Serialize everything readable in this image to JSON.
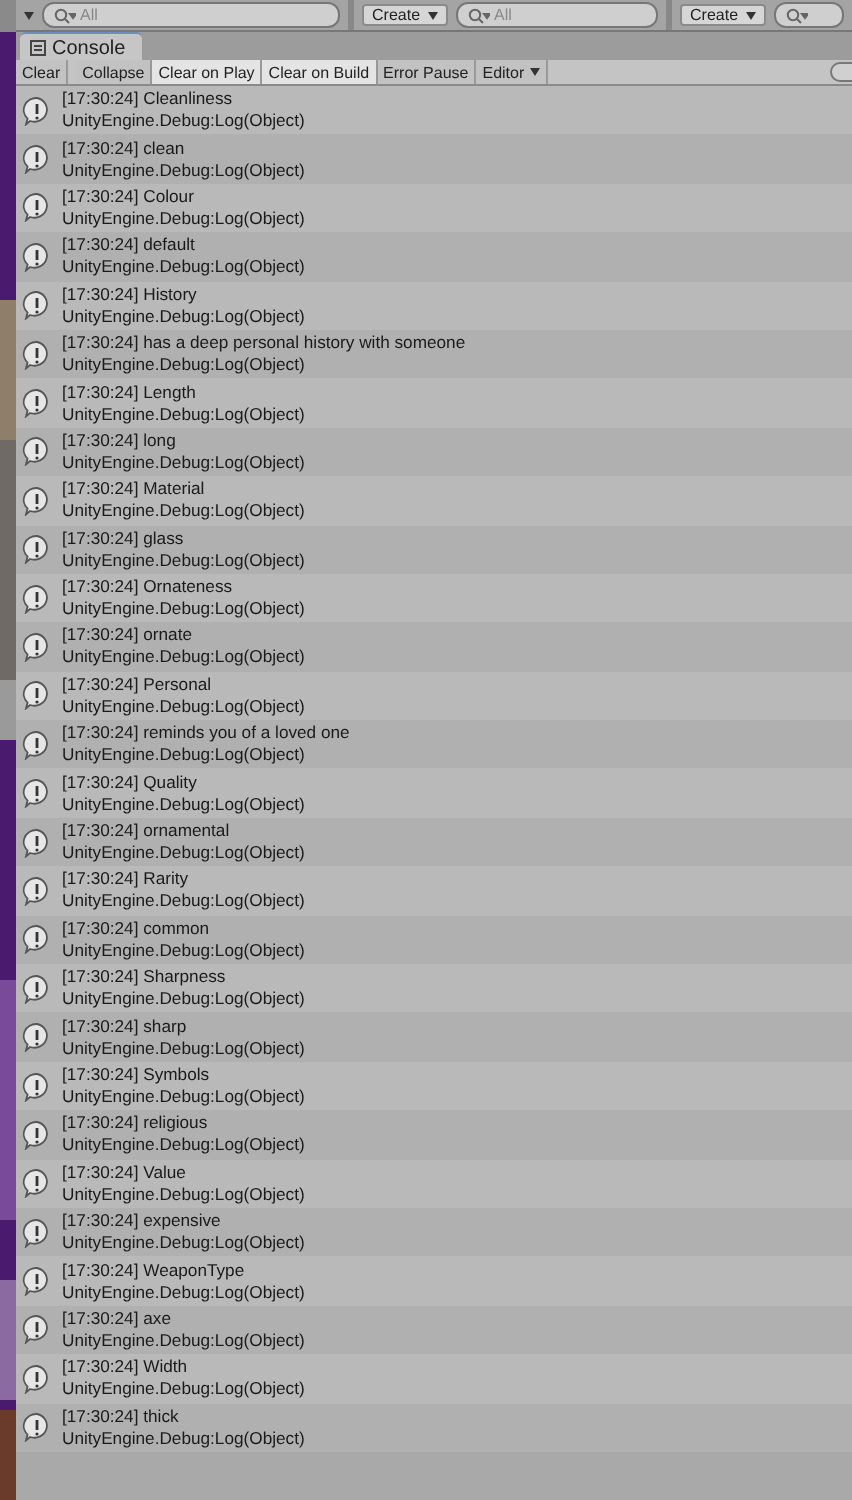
{
  "top_bar": {
    "panels": [
      {
        "search": "All"
      },
      {
        "create": "Create",
        "search": "All"
      },
      {
        "create": "Create"
      }
    ]
  },
  "tab": {
    "label": "Console",
    "selected": true
  },
  "toolbar": [
    {
      "label": "Clear",
      "on": false,
      "kind": "button"
    },
    {
      "label": "Collapse",
      "on": false,
      "kind": "button"
    },
    {
      "label": "Clear on Play",
      "on": true,
      "kind": "toggle"
    },
    {
      "label": "Clear on Build",
      "on": true,
      "kind": "toggle"
    },
    {
      "label": "Error Pause",
      "on": false,
      "kind": "toggle"
    },
    {
      "label": "Editor",
      "on": false,
      "kind": "dropdown"
    }
  ],
  "log": [
    {
      "message": "[17:30:24] Cleanliness",
      "trace": "UnityEngine.Debug:Log(Object)"
    },
    {
      "message": "[17:30:24] clean",
      "trace": "UnityEngine.Debug:Log(Object)"
    },
    {
      "message": "[17:30:24] Colour",
      "trace": "UnityEngine.Debug:Log(Object)"
    },
    {
      "message": "[17:30:24] default",
      "trace": "UnityEngine.Debug:Log(Object)"
    },
    {
      "message": "[17:30:24] History",
      "trace": "UnityEngine.Debug:Log(Object)"
    },
    {
      "message": "[17:30:24] has a deep personal history with someone",
      "trace": "UnityEngine.Debug:Log(Object)"
    },
    {
      "message": "[17:30:24] Length",
      "trace": "UnityEngine.Debug:Log(Object)"
    },
    {
      "message": "[17:30:24] long",
      "trace": "UnityEngine.Debug:Log(Object)"
    },
    {
      "message": "[17:30:24] Material",
      "trace": "UnityEngine.Debug:Log(Object)"
    },
    {
      "message": "[17:30:24] glass",
      "trace": "UnityEngine.Debug:Log(Object)"
    },
    {
      "message": "[17:30:24] Ornateness",
      "trace": "UnityEngine.Debug:Log(Object)"
    },
    {
      "message": "[17:30:24] ornate",
      "trace": "UnityEngine.Debug:Log(Object)"
    },
    {
      "message": "[17:30:24] Personal",
      "trace": "UnityEngine.Debug:Log(Object)"
    },
    {
      "message": "[17:30:24] reminds you of a loved one",
      "trace": "UnityEngine.Debug:Log(Object)"
    },
    {
      "message": "[17:30:24] Quality",
      "trace": "UnityEngine.Debug:Log(Object)"
    },
    {
      "message": "[17:30:24] ornamental",
      "trace": "UnityEngine.Debug:Log(Object)"
    },
    {
      "message": "[17:30:24] Rarity",
      "trace": "UnityEngine.Debug:Log(Object)"
    },
    {
      "message": "[17:30:24] common",
      "trace": "UnityEngine.Debug:Log(Object)"
    },
    {
      "message": "[17:30:24] Sharpness",
      "trace": "UnityEngine.Debug:Log(Object)"
    },
    {
      "message": "[17:30:24] sharp",
      "trace": "UnityEngine.Debug:Log(Object)"
    },
    {
      "message": "[17:30:24] Symbols",
      "trace": "UnityEngine.Debug:Log(Object)"
    },
    {
      "message": "[17:30:24] religious",
      "trace": "UnityEngine.Debug:Log(Object)"
    },
    {
      "message": "[17:30:24] Value",
      "trace": "UnityEngine.Debug:Log(Object)"
    },
    {
      "message": "[17:30:24] expensive",
      "trace": "UnityEngine.Debug:Log(Object)"
    },
    {
      "message": "[17:30:24] WeaponType",
      "trace": "UnityEngine.Debug:Log(Object)"
    },
    {
      "message": "[17:30:24] axe",
      "trace": "UnityEngine.Debug:Log(Object)"
    },
    {
      "message": "[17:30:24] Width",
      "trace": "UnityEngine.Debug:Log(Object)"
    },
    {
      "message": "[17:30:24] thick",
      "trace": "UnityEngine.Debug:Log(Object)"
    }
  ]
}
